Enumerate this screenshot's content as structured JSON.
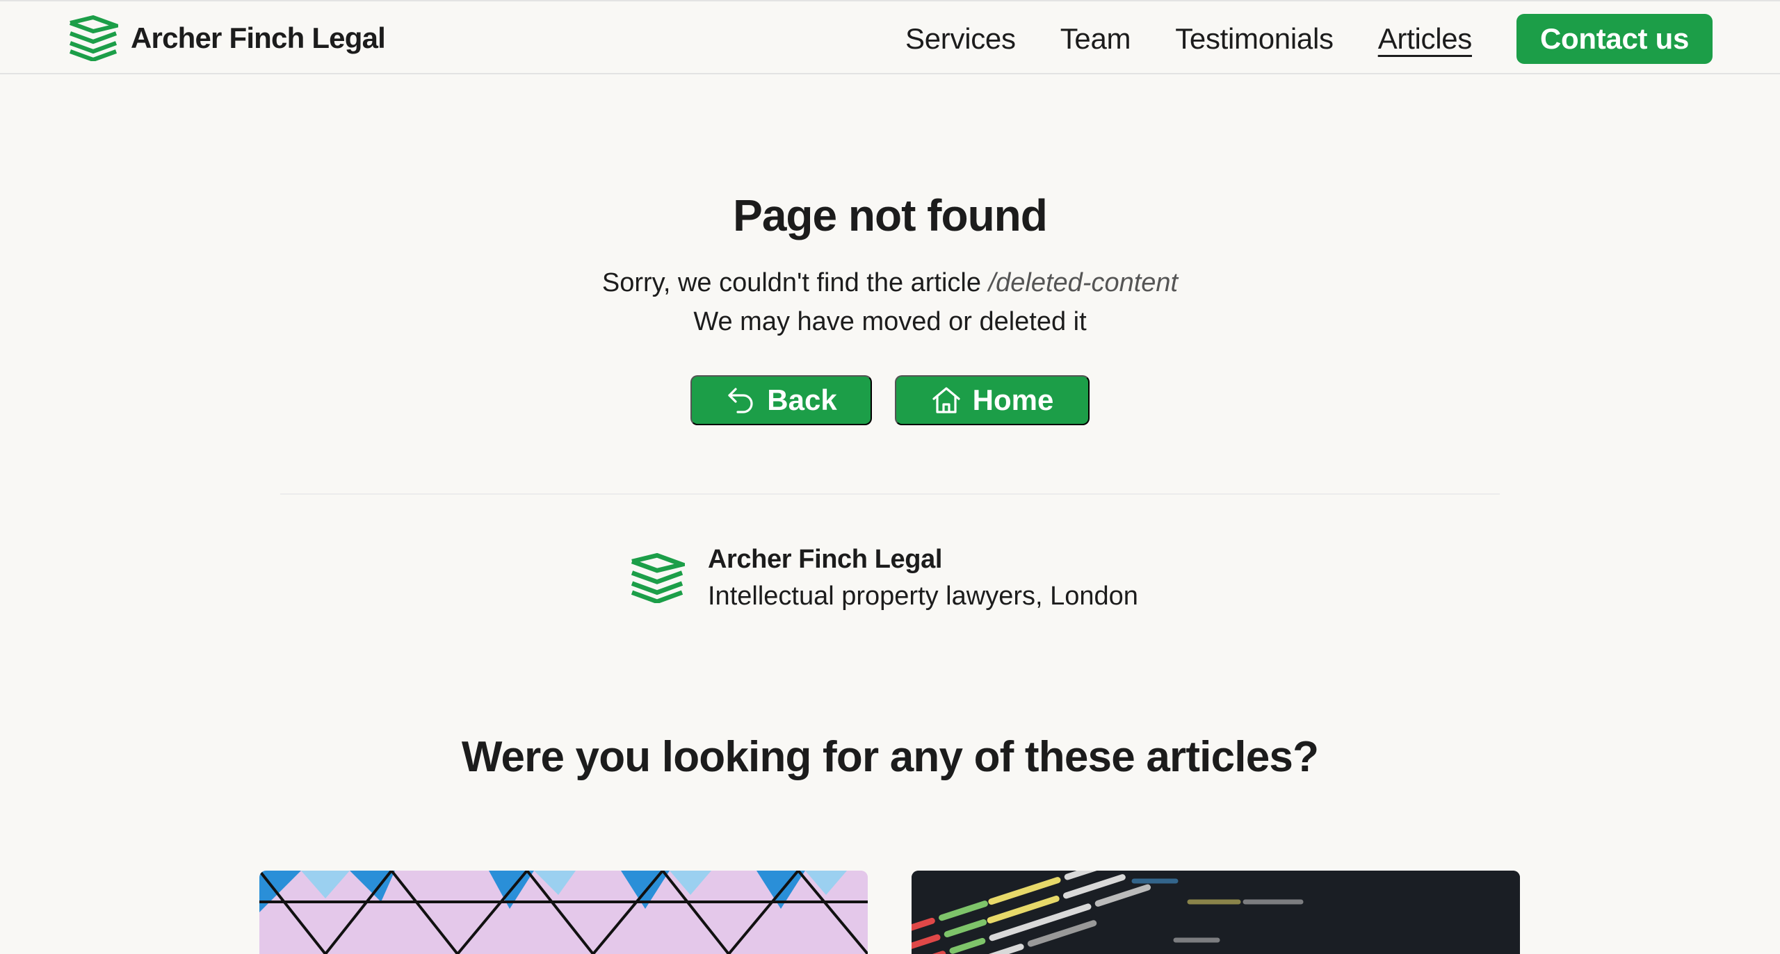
{
  "header": {
    "brand_name": "Archer Finch Legal",
    "nav": [
      {
        "label": "Services",
        "active": false
      },
      {
        "label": "Team",
        "active": false
      },
      {
        "label": "Testimonials",
        "active": false
      },
      {
        "label": "Articles",
        "active": true
      }
    ],
    "contact_label": "Contact us"
  },
  "error": {
    "title": "Page not found",
    "sorry_text": "Sorry, we couldn't find the article",
    "path": "/deleted-content",
    "moved_text": "We may have moved or deleted it",
    "back_label": "Back",
    "home_label": "Home"
  },
  "firm": {
    "name": "Archer Finch Legal",
    "description": "Intellectual property lawyers, London"
  },
  "suggestions": {
    "heading": "Were you looking for any of these articles?",
    "cards": [
      {
        "image": "pink-blue-geometric-pattern"
      },
      {
        "image": "dark-php-code-screen"
      }
    ]
  },
  "colors": {
    "accent": "#1c9e48",
    "background": "#f9f8f5",
    "text": "#1c1c1c",
    "muted": "#555555"
  },
  "icons": {
    "logo": "chevron-stack-logo",
    "back": "undo-arrow-icon",
    "home": "house-icon"
  }
}
